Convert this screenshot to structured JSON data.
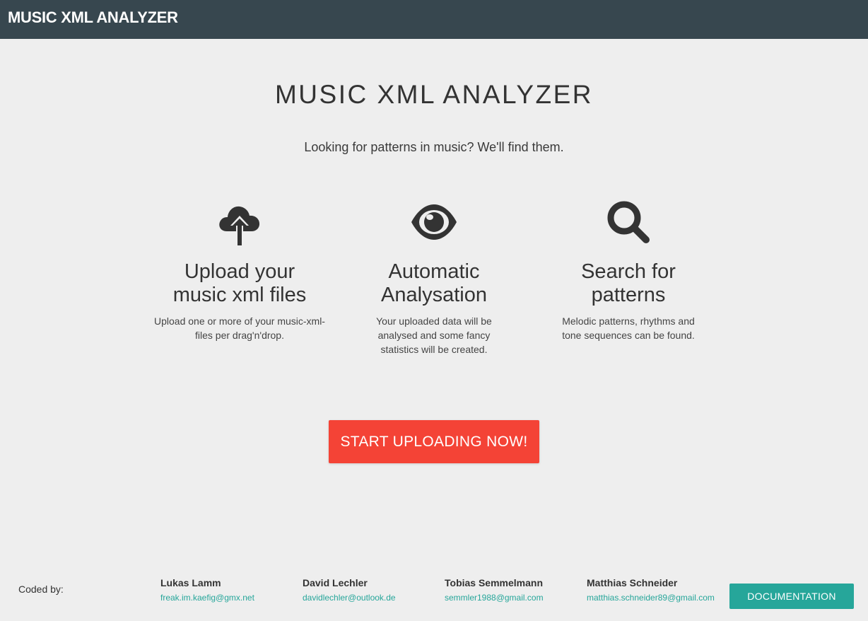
{
  "navbar": {
    "brand": "MUSIC XML ANALYZER"
  },
  "hero": {
    "title": "MUSIC XML ANALYZER",
    "tagline": "Looking for patterns in music? We'll find them."
  },
  "features": [
    {
      "icon": "cloud-upload-icon",
      "title_line1": "Upload your",
      "title_line2": "music xml files",
      "text": "Upload one or more of your music-xml-files per drag'n'drop."
    },
    {
      "icon": "eye-icon",
      "title_line1": "Automatic",
      "title_line2": "Analysation",
      "text": "Your uploaded data will be analysed and some fancy statistics will be created."
    },
    {
      "icon": "search-icon",
      "title_line1": "Search for",
      "title_line2": "patterns",
      "text": "Melodic patterns, rhythms and tone sequences can be found."
    }
  ],
  "cta": {
    "label": "START UPLOADING NOW!"
  },
  "footer": {
    "coded_by": "Coded by:",
    "authors": [
      {
        "name": "Lukas Lamm",
        "email": "freak.im.kaefig@gmx.net"
      },
      {
        "name": "David Lechler",
        "email": "davidlechler@outlook.de"
      },
      {
        "name": "Tobias Semmelmann",
        "email": "semmler1988@gmail.com"
      },
      {
        "name": "Matthias Schneider",
        "email": "matthias.schneider89@gmail.com"
      }
    ],
    "documentation_label": "DOCUMENTATION"
  },
  "colors": {
    "navbar": "#37474f",
    "background": "#eeeeee",
    "cta": "#f44336",
    "accent": "#26a69a",
    "icon": "#333333"
  }
}
